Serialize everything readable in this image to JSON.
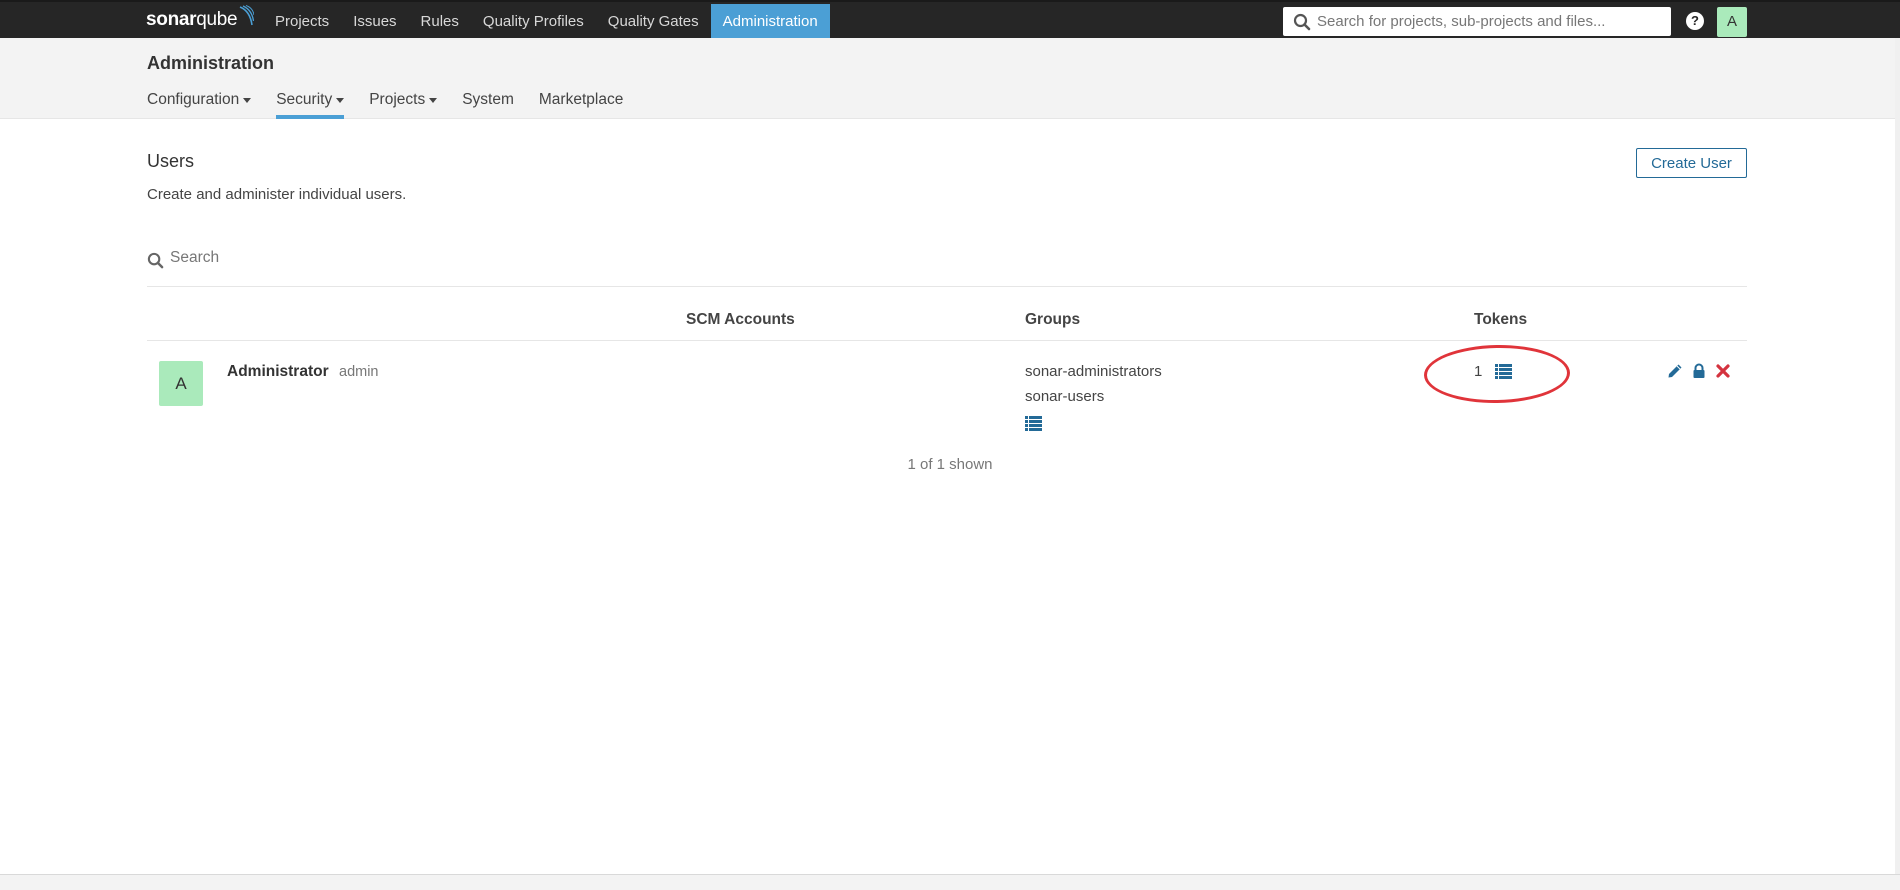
{
  "app": {
    "logo_bold": "sonar",
    "logo_light": "qube",
    "nav": [
      {
        "label": "Projects",
        "active": false
      },
      {
        "label": "Issues",
        "active": false
      },
      {
        "label": "Rules",
        "active": false
      },
      {
        "label": "Quality Profiles",
        "active": false
      },
      {
        "label": "Quality Gates",
        "active": false
      },
      {
        "label": "Administration",
        "active": true
      }
    ],
    "search_placeholder": "Search for projects, sub-projects and files...",
    "help_icon": "question-circle-icon",
    "user_initial": "A"
  },
  "admin": {
    "title": "Administration",
    "subnav": [
      {
        "label": "Configuration",
        "dropdown": true,
        "active": false
      },
      {
        "label": "Security",
        "dropdown": true,
        "active": true
      },
      {
        "label": "Projects",
        "dropdown": true,
        "active": false
      },
      {
        "label": "System",
        "dropdown": false,
        "active": false
      },
      {
        "label": "Marketplace",
        "dropdown": false,
        "active": false
      }
    ]
  },
  "page": {
    "title": "Users",
    "description": "Create and administer individual users.",
    "create_button": "Create User",
    "search_placeholder": "Search"
  },
  "table": {
    "columns": [
      "",
      "SCM Accounts",
      "Groups",
      "Tokens",
      ""
    ],
    "rows": [
      {
        "avatar_initial": "A",
        "name": "Administrator",
        "login": "admin",
        "scm_accounts": [],
        "groups": [
          "sonar-administrators",
          "sonar-users"
        ],
        "tokens": "1",
        "actions": [
          "edit-icon",
          "lock-icon",
          "delete-icon"
        ]
      }
    ]
  },
  "pagination": "1 of 1 shown",
  "colors": {
    "topbar": "#262626",
    "accent": "#4b9fd5",
    "button_text": "#236a97",
    "avatar": "#aaeabb",
    "delete": "#d4333f",
    "annotation": "#e0343a"
  }
}
